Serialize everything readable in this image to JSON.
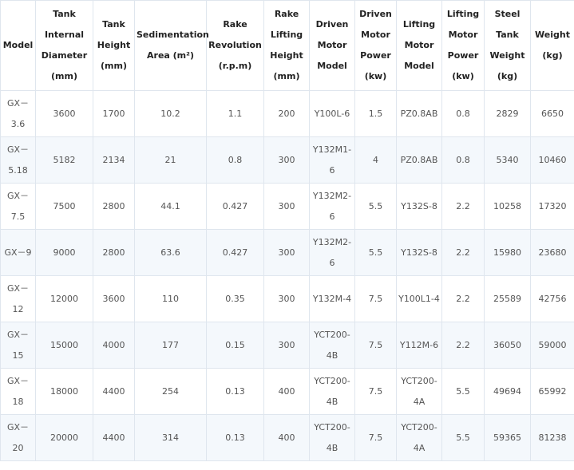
{
  "table": {
    "headers": [
      "Model",
      "Tank\nInternal\nDiameter\n(mm)",
      "Tank\nHeight\n(mm)",
      "Sedimentation\nArea (m²)",
      "Rake\nRevolution\n(r.p.m)",
      "Rake\nLifting\nHeight\n(mm)",
      "Driven\nMotor\nModel",
      "Driven\nMotor\nPower\n(kw)",
      "Lifting\nMotor\nModel",
      "Lifting\nMotor\nPower\n(kw)",
      "Steel\nTank\nWeight\n(kg)",
      "Weight\n(kg)"
    ],
    "rows": [
      [
        "GX－\n3.6",
        "3600",
        "1700",
        "10.2",
        "1.1",
        "200",
        "Y100L-6",
        "1.5",
        "PZ0.8AB",
        "0.8",
        "2829",
        "6650"
      ],
      [
        "GX－\n5.18",
        "5182",
        "2134",
        "21",
        "0.8",
        "300",
        "Y132M1-\n6",
        "4",
        "PZ0.8AB",
        "0.8",
        "5340",
        "10460"
      ],
      [
        "GX－\n7.5",
        "7500",
        "2800",
        "44.1",
        "0.427",
        "300",
        "Y132M2-\n6",
        "5.5",
        "Y132S-8",
        "2.2",
        "10258",
        "17320"
      ],
      [
        "GX－9",
        "9000",
        "2800",
        "63.6",
        "0.427",
        "300",
        "Y132M2-\n6",
        "5.5",
        "Y132S-8",
        "2.2",
        "15980",
        "23680"
      ],
      [
        "GX－\n12",
        "12000",
        "3600",
        "110",
        "0.35",
        "300",
        "Y132M-4",
        "7.5",
        "Y100L1-4",
        "2.2",
        "25589",
        "42756"
      ],
      [
        "GX－\n15",
        "15000",
        "4000",
        "177",
        "0.15",
        "300",
        "YCT200-\n4B",
        "7.5",
        "Y112M-6",
        "2.2",
        "36050",
        "59000"
      ],
      [
        "GX－\n18",
        "18000",
        "4400",
        "254",
        "0.13",
        "400",
        "YCT200-\n4B",
        "7.5",
        "YCT200-\n4A",
        "5.5",
        "49694",
        "65992"
      ],
      [
        "GX－\n20",
        "20000",
        "4400",
        "314",
        "0.13",
        "400",
        "YCT200-\n4B",
        "7.5",
        "YCT200-\n4A",
        "5.5",
        "59365",
        "81238"
      ]
    ]
  }
}
